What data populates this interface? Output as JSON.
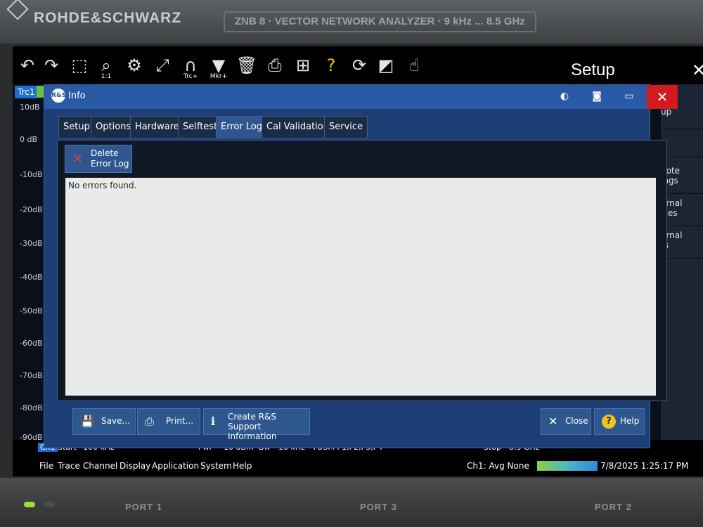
{
  "device": {
    "brand": "ROHDE&SCHWARZ",
    "model_plate": "ZNB 8 · VECTOR NETWORK ANALYZER · 9 kHz ... 8.5 GHz",
    "ports": [
      "PORT 1",
      "PORT 3",
      "PORT 2"
    ]
  },
  "toolbar": {
    "icons": [
      "undo-icon",
      "redo-icon",
      "zoom-rect-icon",
      "zoom-11-icon",
      "zoom-settings-icon",
      "fullscreen-icon",
      "trace-add-icon",
      "marker-add-icon",
      "delete-icon",
      "print-icon",
      "windows-icon",
      "help-icon",
      "refresh-icon",
      "display-icon",
      "touch-icon"
    ],
    "zoom_11_label": "1:1",
    "trc_label": "Trc+",
    "mkr_label": "Mkr+",
    "help_glyph": "?",
    "panel_title": "Setup"
  },
  "trace": {
    "label": "Trc1",
    "y_ticks": [
      "10dB",
      "0 dB",
      "-10dB",
      "-20dB",
      "-30dB",
      "-40dB",
      "-50dB",
      "-60dB",
      "-70dB",
      "-80dB",
      "-90dB"
    ]
  },
  "right_panel": {
    "items": [
      "up",
      "-",
      "note\nings",
      "ernal\nices",
      "ernal\nts"
    ]
  },
  "dialog": {
    "title": "Info",
    "logo_text": "R&S",
    "tabs": [
      "Setup",
      "Options",
      "Hardware",
      "Selftest",
      "Error Log",
      "Cal Validation",
      "Service"
    ],
    "active_tab": "Error Log",
    "delete_button": "Delete\nError Log",
    "log_text": "No errors found.",
    "buttons": {
      "save": "Save...",
      "print": "Print...",
      "support": "Create R&S\nSupport Information",
      "close": "Close",
      "help": "Help"
    }
  },
  "status": {
    "channel": "Ch1",
    "start_label": "Start",
    "start_value": "100 kHz",
    "pwr_label": "Pwr",
    "pwr_value": "-10 dBm",
    "bw_label": "Bw",
    "bw_value": "10 kHz",
    "cal": "TOSM P1,P2,P3,P4",
    "stop_label": "Stop",
    "stop_value": "8.5 GHz",
    "avg": "Ch1: Avg None",
    "datetime": "7/8/2025 1:25:17 PM"
  },
  "menu": [
    "File",
    "Trace",
    "Channel",
    "Display",
    "Application",
    "System",
    "Help"
  ],
  "colors": {
    "accent": "#2a5aa6",
    "close_red": "#d4191f",
    "help_yellow": "#f3c21b",
    "log_bg": "#e9ebe9",
    "ok_green": "#6bc23a"
  }
}
